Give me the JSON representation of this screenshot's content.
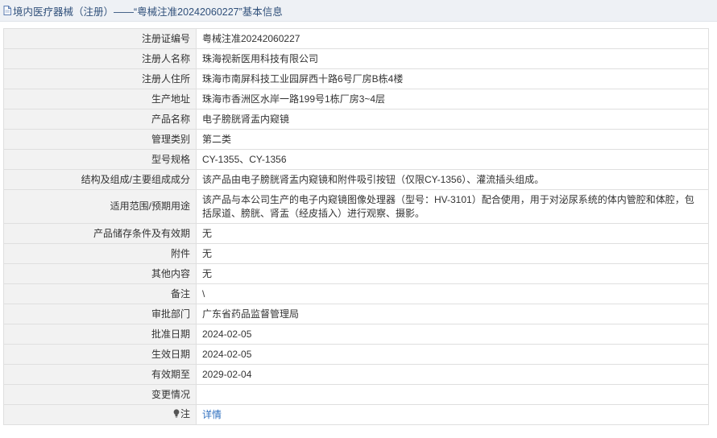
{
  "header": {
    "title": "境内医疗器械（注册）——“粤械注准20242060227”基本信息",
    "accent_color": "#30507a"
  },
  "rows": [
    {
      "label": "注册证编号",
      "value": "粤械注准20242060227"
    },
    {
      "label": "注册人名称",
      "value": "珠海视新医用科技有限公司"
    },
    {
      "label": "注册人住所",
      "value": "珠海市南屏科技工业园屏西十路6号厂房B栋4楼"
    },
    {
      "label": "生产地址",
      "value": "珠海市香洲区水岸一路199号1栋厂房3~4层"
    },
    {
      "label": "产品名称",
      "value": "电子膀胱肾盂内窥镜"
    },
    {
      "label": "管理类别",
      "value": "第二类"
    },
    {
      "label": "型号规格",
      "value": "CY-1355、CY-1356"
    },
    {
      "label": "结构及组成/主要组成成分",
      "value": "该产品由电子膀胱肾盂内窥镜和附件吸引按钮（仅限CY-1356）、灌流插头组成。"
    },
    {
      "label": "适用范围/预期用途",
      "value": "该产品与本公司生产的电子内窥镜图像处理器（型号：HV-3101）配合使用，用于对泌尿系统的体内管腔和体腔，包括尿道、膀胱、肾盂（经皮插入）进行观察、摄影。"
    },
    {
      "label": "产品储存条件及有效期",
      "value": "无"
    },
    {
      "label": "附件",
      "value": "无"
    },
    {
      "label": "其他内容",
      "value": "无"
    },
    {
      "label": "备注",
      "value": "\\"
    },
    {
      "label": "审批部门",
      "value": "广东省药品监督管理局"
    },
    {
      "label": "批准日期",
      "value": "2024-02-05"
    },
    {
      "label": "生效日期",
      "value": "2024-02-05"
    },
    {
      "label": "有效期至",
      "value": "2029-02-04"
    },
    {
      "label": "变更情况",
      "value": ""
    }
  ],
  "note": {
    "label": "注",
    "link_text": "详情",
    "icon": "lightbulb-icon"
  }
}
